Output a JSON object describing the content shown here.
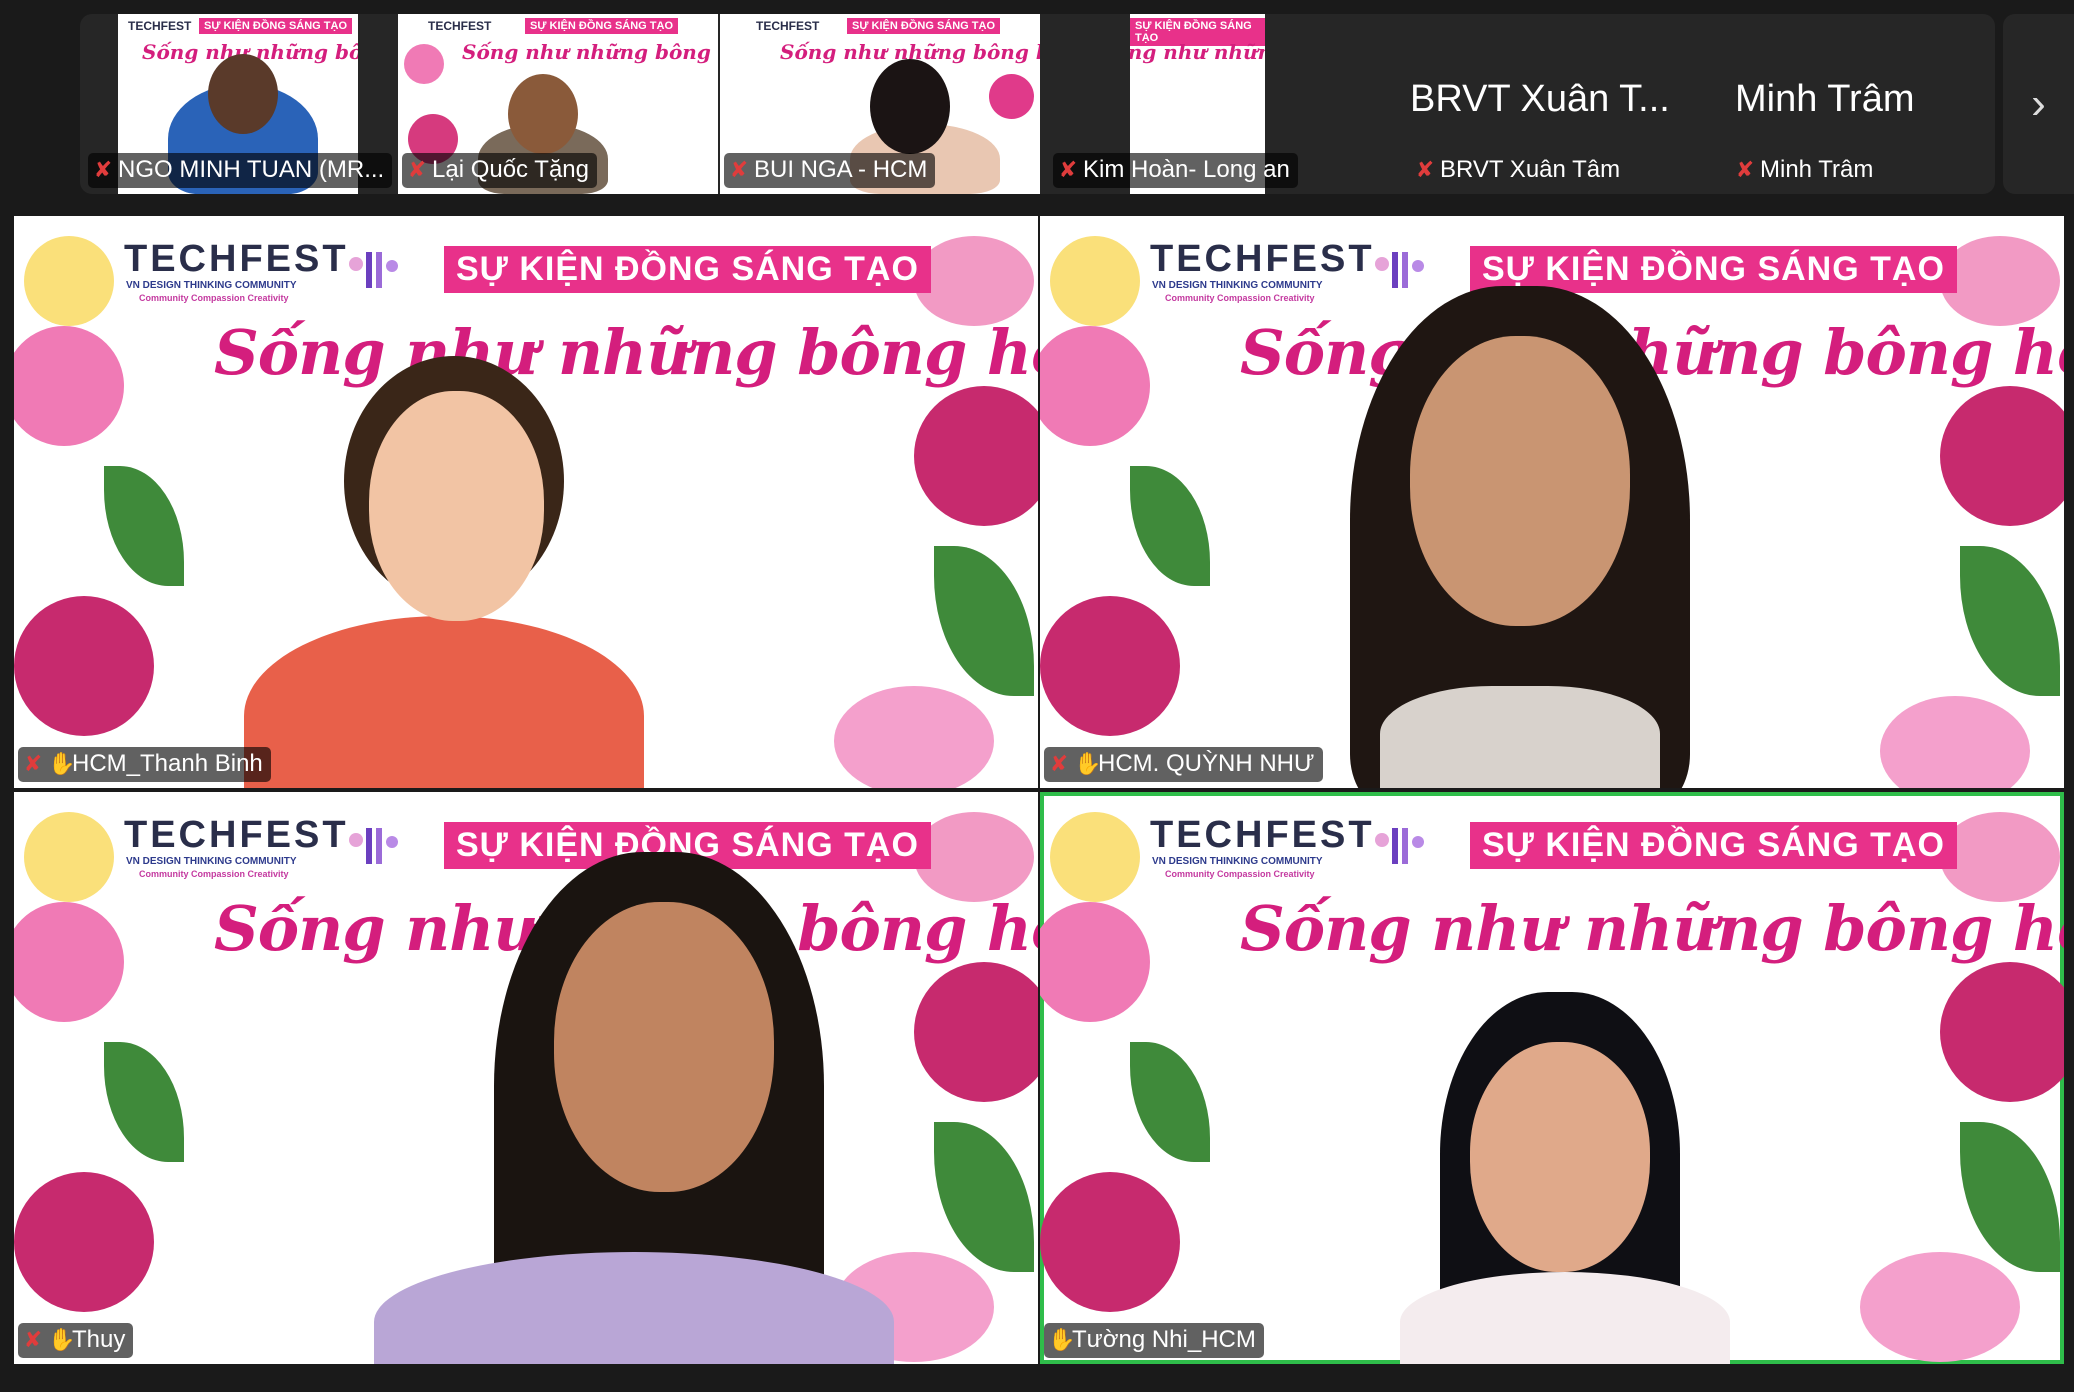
{
  "strip": {
    "participants": [
      {
        "name": "NGO MINH TUAN (MR...",
        "muted": true
      },
      {
        "name": "Lại Quốc Tặng",
        "muted": true
      },
      {
        "name": "BUI NGA - HCM",
        "muted": true
      },
      {
        "name": "Kim Hoàn- Long an",
        "muted": true
      },
      {
        "name": "BRVT Xuân Tâm",
        "display": "BRVT Xuân T...",
        "muted": true
      },
      {
        "name": "Minh Trâm",
        "display": "Minh Trâm",
        "muted": true
      }
    ],
    "mini_banner": "SỰ KIỆN ĐỒNG SÁNG TẠO",
    "mini_tech": "TECHFEST",
    "mini_script": "Sống như những bông hoa",
    "next_icon": "chevron-right-icon"
  },
  "background": {
    "techfest": "TECHFEST",
    "techfest_sub1": "VN DESIGN THINKING COMMUNITY",
    "techfest_sub2": "Community Compassion Creativity",
    "banner": "SỰ KIỆN ĐỒNG SÁNG TẠO",
    "script": "Sống như những bông hoa"
  },
  "tiles": [
    {
      "name": "HCM_Thanh Binh",
      "muted": true,
      "hand": true,
      "active": false
    },
    {
      "name": "HCM.  QUỲNH NHƯ",
      "muted": true,
      "hand": true,
      "active": false
    },
    {
      "name": "Thuy",
      "muted": true,
      "hand": true,
      "active": false
    },
    {
      "name": "Tường Nhi_HCM",
      "muted": false,
      "hand": true,
      "active": true
    }
  ],
  "colors": {
    "banner_pink": "#e8318a",
    "script_pink": "#d41e7d",
    "active_speaker": "#2fbd4a",
    "mute_red": "#e03c3c"
  }
}
